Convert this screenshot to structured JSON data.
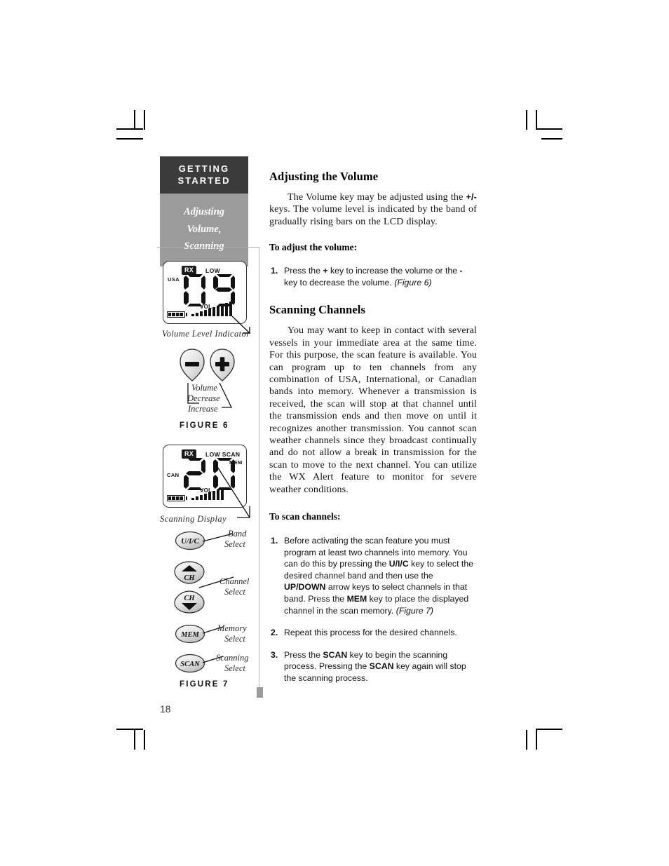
{
  "page": {
    "number": "18"
  },
  "sidebar": {
    "tab_dark_line1": "GETTING",
    "tab_dark_line2": "STARTED",
    "tab_grey_line1": "Adjusting",
    "tab_grey_line2": "Volume,",
    "tab_grey_line3": "Scanning"
  },
  "figure6": {
    "lcd": {
      "rx": "RX",
      "low": "LOW",
      "band": "USA",
      "channel": "09",
      "vol_label": "VOL",
      "bar_count": 10,
      "battery_segments": 4
    },
    "lcd_caption": "Volume Level Indicator",
    "buttons": [
      {
        "name": "minus-button",
        "glyph": "minus"
      },
      {
        "name": "plus-button",
        "glyph": "plus"
      }
    ],
    "label_line1": "Volume",
    "label_line2": "Decrease",
    "label_line3": "Increase",
    "caption": "FIGURE 6"
  },
  "figure7": {
    "lcd": {
      "rx": "RX",
      "low_scan": "LOW SCAN",
      "mem": "MEM",
      "band": "CAN",
      "channel": "20",
      "vol_label": "VOL",
      "bar_count": 8,
      "battery_segments": 4
    },
    "lcd_caption": "Scanning Display",
    "buttons": [
      {
        "name": "uic-button",
        "label": "U/I/C",
        "desc_line1": "Band",
        "desc_line2": "Select"
      },
      {
        "name": "channel-up-button",
        "label": "CH",
        "desc_line1": "Channel",
        "desc_line2": "Select"
      },
      {
        "name": "channel-down-button",
        "label": "CH",
        "desc_line1": "",
        "desc_line2": ""
      },
      {
        "name": "mem-button",
        "label": "MEM",
        "desc_line1": "Memory",
        "desc_line2": "Select"
      },
      {
        "name": "scan-button",
        "label": "SCAN",
        "desc_line1": "Scanning",
        "desc_line2": "Select"
      }
    ],
    "caption": "FIGURE 7"
  },
  "content": {
    "heading_volume": "Adjusting the Volume",
    "para_volume_a": "The Volume key may be adjusted using the ",
    "para_volume_sym": "+/-",
    "para_volume_b": " keys. The volume level is indicated by the band of gradually rising bars on the LCD display.",
    "lead_adjust": "To adjust the volume:",
    "step_adjust_num": "1.",
    "step_adjust_a": "Press the ",
    "step_adjust_plus": "+",
    "step_adjust_b": " key to increase the volume or the ",
    "step_adjust_minus": "-",
    "step_adjust_c": " key to decrease the volume. ",
    "step_adjust_fig": "(Figure 6)",
    "heading_scanning": "Scanning Channels",
    "para_scanning": "You may want to keep in contact with several vessels in your immediate area at the same time. For this purpose, the scan feature is available. You can program up to ten channels from any combination of USA, International, or Canadian bands into memory. Whenever a transmission is received, the scan will stop at that channel until the transmission ends and then move on until it recognizes another transmission. You cannot scan weather channels since they broadcast continually and do not allow a break in transmission for the scan to move to the next channel. You can utilize the WX Alert feature to monitor for severe weather conditions.",
    "lead_scan": "To scan channels:",
    "step1_num": "1.",
    "step1_a": "Before activating the scan feature you must program at least two channels into memory. You can do this by pressing the ",
    "step1_b1": "U/I/C",
    "step1_b": " key to select the desired channel band and then use the ",
    "step1_b2": "UP/DOWN",
    "step1_c": " arrow keys to select channels in that band. Press the ",
    "step1_b3": "MEM",
    "step1_d": " key to place the displayed channel in the scan memory. ",
    "step1_fig": "(Figure 7)",
    "step2_num": "2.",
    "step2_text": "Repeat this process for the desired channels.",
    "step3_num": "3.",
    "step3_a": "Press the ",
    "step3_b1": "SCAN",
    "step3_b": " key to begin the scanning process. Pressing the ",
    "step3_b2": "SCAN",
    "step3_c": " key again will stop the scanning process."
  },
  "colors": {
    "tab_dark": "#3b3b3b",
    "tab_grey": "#9b9b9b",
    "rule": "#b4b4b4",
    "text": "#111111"
  }
}
